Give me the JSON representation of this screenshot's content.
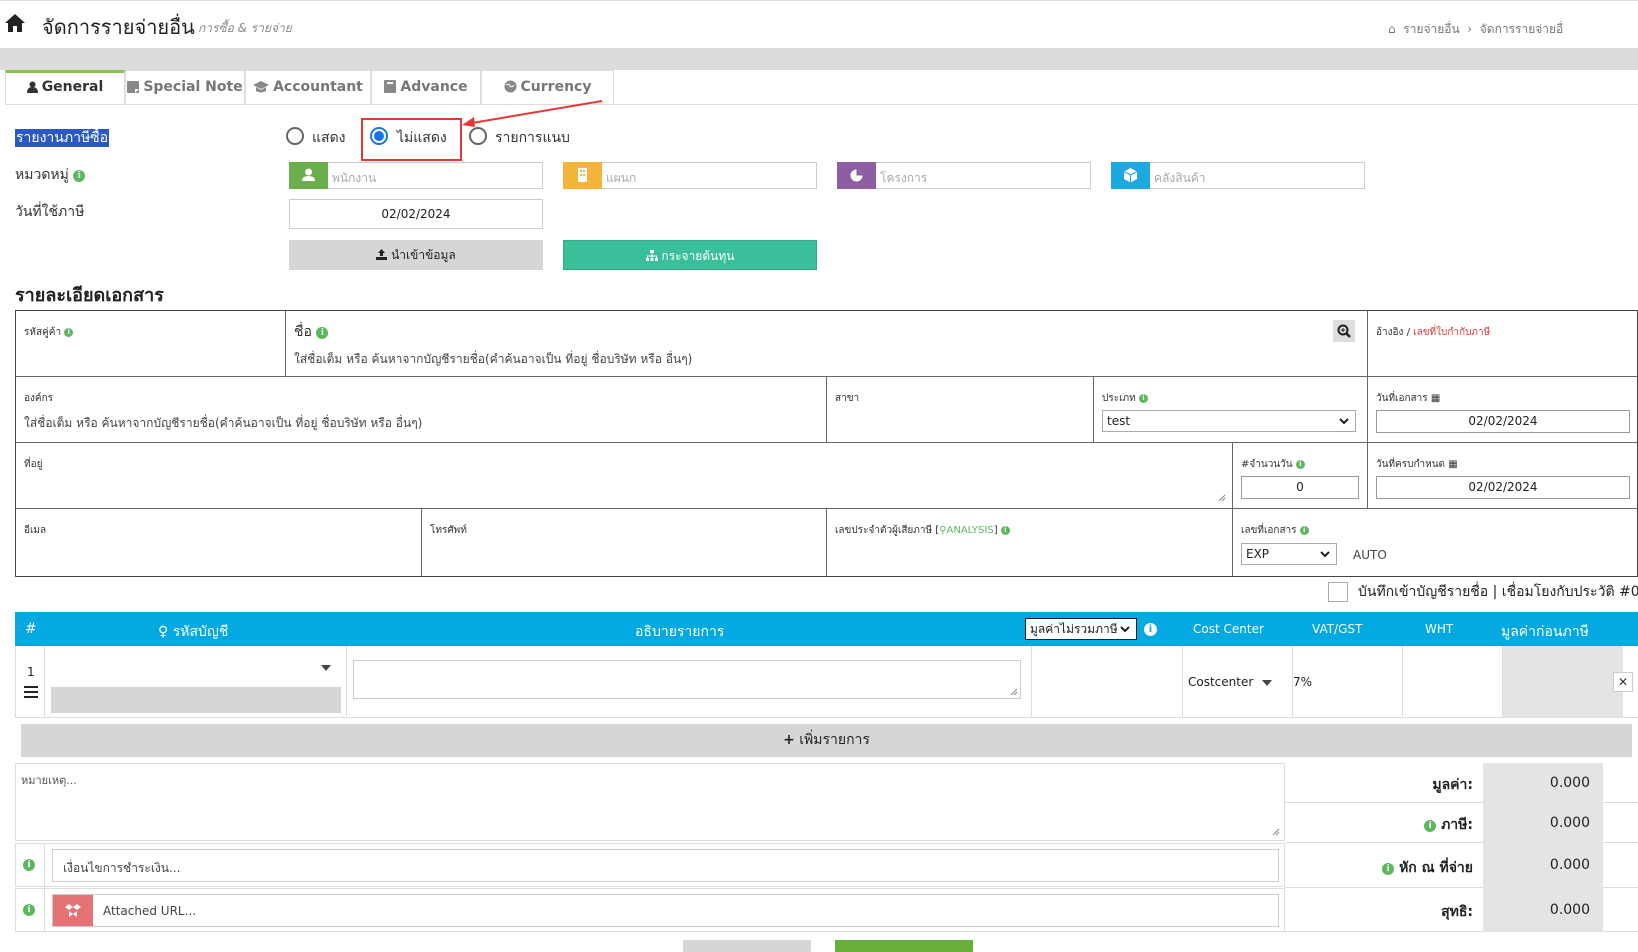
{
  "header": {
    "title": "จัดการรายจ่ายอื่น",
    "subtitle": "การซื้อ & รายจ่าย",
    "breadcrumb": [
      "รายจ่ายอื่น",
      "จัดการรายจ่ายอื่"
    ]
  },
  "tabs": [
    {
      "label": "General",
      "icon": "user-icon",
      "active": true
    },
    {
      "label": "Special Note",
      "icon": "note-icon"
    },
    {
      "label": "Accountant",
      "icon": "graduation-cap-icon"
    },
    {
      "label": "Advance",
      "icon": "book-icon"
    },
    {
      "label": "Currency",
      "icon": "globe-icon"
    }
  ],
  "tax_report": {
    "label": "รายงานภาษีซื้อ",
    "options": [
      "แสดง",
      "ไม่แสดง",
      "รายการแนบ"
    ],
    "selected": "ไม่แสดง"
  },
  "category": {
    "label": "หมวดหมู่",
    "fields": [
      {
        "placeholder": "พนักงาน",
        "color": "#6aaf4b",
        "icon": "user-icon"
      },
      {
        "placeholder": "แผนก",
        "color": "#f5b53a",
        "icon": "building-icon"
      },
      {
        "placeholder": "โครงการ",
        "color": "#8e5ea2",
        "icon": "pie-chart-icon"
      },
      {
        "placeholder": "คลังสินค้า",
        "color": "#1ba9e0",
        "icon": "cube-icon"
      }
    ]
  },
  "tax_date": {
    "label": "วันที่ใช้ภาษี",
    "value": "02/02/2024"
  },
  "buttons": {
    "import": "นำเข้าข้อมูล",
    "distribute": "กระจายต้นทุน"
  },
  "doc_section": {
    "title": "รายละเอียดเอกสาร",
    "vendor_code_label": "รหัสคู่ค้า",
    "name_label": "ชื่อ",
    "name_placeholder": "ใส่ชื่อเต็ม หรือ ค้นหาจากบัญชีรายชื่อ(คำค้นอาจเป็น ที่อยู่ ชื่อบริษัท หรือ อื่นๆ)",
    "reference_label": "อ้างอิง",
    "reference_sep": "/",
    "reference_link": "เลขที่ใบกำกับภาษี",
    "org_label": "องค์กร",
    "org_placeholder": "ใส่ชื่อเต็ม หรือ ค้นหาจากบัญชีรายชื่อ(คำค้นอาจเป็น ที่อยู่ ชื่อบริษัท หรือ อื่นๆ)",
    "branch_label": "สาขา",
    "type_label": "ประเภท",
    "type_value": "test",
    "doc_date_label": "วันที่เอกสาร",
    "doc_date": "02/02/2024",
    "address_label": "ที่อยู่",
    "days_label": "#จำนวนวัน",
    "days_value": "0",
    "due_date_label": "วันที่ครบกำหนด",
    "due_date": "02/02/2024",
    "email_label": "อีเมล",
    "phone_label": "โทรศัพท์",
    "taxid_label": "เลขประจำตัวผู้เสียภาษี [",
    "taxid_link": "ANALYSIS",
    "taxid_end": "]",
    "docno_label": "เลขที่เอกสาร",
    "docno_prefix": "EXP",
    "docno_auto": "AUTO"
  },
  "save_to_contacts": "บันทึกเข้าบัญชีรายชื่อ | เชื่อมโยงกับประวัติ #0",
  "items_table": {
    "headers": {
      "num": "#",
      "account": "รหัสบัญชี",
      "description": "อธิบายรายการ",
      "price_mode": "มูลค่าไม่รวมภาษี",
      "cost_center": "Cost Center",
      "vat": "VAT/GST",
      "wht": "WHT",
      "pretax": "มูลค่าก่อนภาษี"
    },
    "rows": [
      {
        "num": "1",
        "cost_center": "Costcenter",
        "vat": "7%"
      }
    ],
    "add_row": "เพิ่มรายการ"
  },
  "notes": {
    "remark_placeholder": "หมายเหตุ...",
    "payment_placeholder": "เงื่อนไขการชำระเงิน...",
    "attached_placeholder": "Attached URL..."
  },
  "summary": {
    "value_label": "มูลค่า:",
    "value": "0.000",
    "tax_label": "ภาษี:",
    "tax": "0.000",
    "wht_label": "หัก ณ ที่จ่าย",
    "wht": "0.000",
    "net_label": "สุทธิ:",
    "net": "0.000"
  }
}
